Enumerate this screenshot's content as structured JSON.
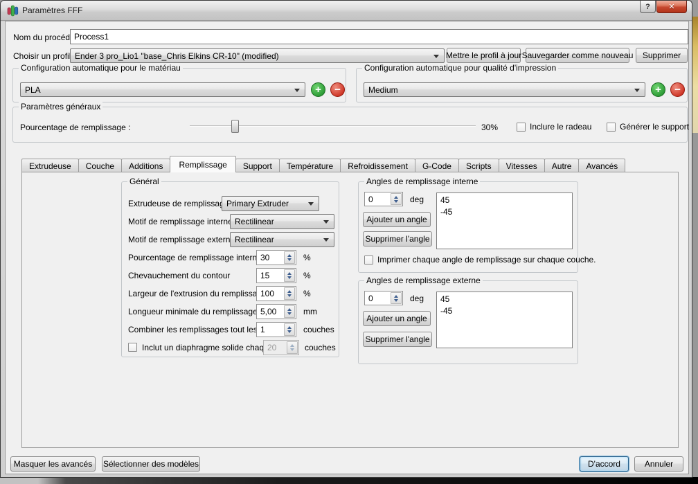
{
  "window": {
    "title": "Paramètres FFF"
  },
  "icons": {
    "help": "?",
    "close": "✕",
    "add": "+",
    "remove": "−"
  },
  "process": {
    "label": "Nom du procédé :",
    "value": "Process1"
  },
  "profile": {
    "label": "Choisir un profil :",
    "value": "Ender 3 pro_Lio1 \"base_Chris Elkins CR-10\" (modified)",
    "update": "Mettre le profil à jour",
    "save_new": "Sauvegarder comme nouveau",
    "delete": "Supprimer"
  },
  "auto_material": {
    "legend": "Configuration automatique pour le matériau",
    "value": "PLA"
  },
  "auto_quality": {
    "legend": "Configuration automatique pour qualité d'impression",
    "value": "Medium"
  },
  "general": {
    "legend": "Paramètres généraux",
    "infill_label": "Pourcentage de remplissage :",
    "infill_value": "30%",
    "raft": "Inclure le radeau",
    "support": "Générer le support"
  },
  "tabs": {
    "items": [
      "Extrudeuse",
      "Couche",
      "Additions",
      "Remplissage",
      "Support",
      "Température",
      "Refroidissement",
      "G-Code",
      "Scripts",
      "Vitesses",
      "Autre",
      "Avancés"
    ],
    "active": "Remplissage"
  },
  "general_group": {
    "legend": "Général",
    "extruder": {
      "label": "Extrudeuse de remplissage",
      "value": "Primary Extruder"
    },
    "internal_pattern": {
      "label": "Motif de remplissage interne",
      "value": "Rectilinear"
    },
    "external_pattern": {
      "label": "Motif de remplissage externe",
      "value": "Rectilinear"
    },
    "infill_percent": {
      "label": "Pourcentage de remplissage interne",
      "value": "30",
      "suffix": "%"
    },
    "outline_overlap": {
      "label": "Chevauchement du contour",
      "value": "15",
      "suffix": "%"
    },
    "extrusion_width": {
      "label": "Largeur de l'extrusion du remplissage",
      "value": "100",
      "suffix": "%"
    },
    "min_length": {
      "label": "Longueur minimale du remplissage",
      "value": "5,00",
      "suffix": "mm"
    },
    "combine": {
      "label": "Combiner les remplissages tout les",
      "value": "1",
      "suffix": "couches"
    },
    "diaphragm": {
      "label": "Inclut un diaphragme solide chaque",
      "value": "20",
      "suffix": "couches"
    }
  },
  "internal_angles": {
    "legend": "Angles de remplissage interne",
    "value": "0",
    "unit": "deg",
    "add": "Ajouter un angle",
    "remove": "Supprimer l'angle",
    "list": [
      "45",
      "-45"
    ],
    "print_every": "Imprimer chaque angle de remplissage sur chaque couche."
  },
  "external_angles": {
    "legend": "Angles de remplissage externe",
    "value": "0",
    "unit": "deg",
    "add": "Ajouter un angle",
    "remove": "Supprimer l'angle",
    "list": [
      "45",
      "-45"
    ]
  },
  "footer": {
    "hide_advanced": "Masquer les avancés",
    "select_models": "Sélectionner des modèles",
    "ok": "D'accord",
    "cancel": "Annuler"
  }
}
